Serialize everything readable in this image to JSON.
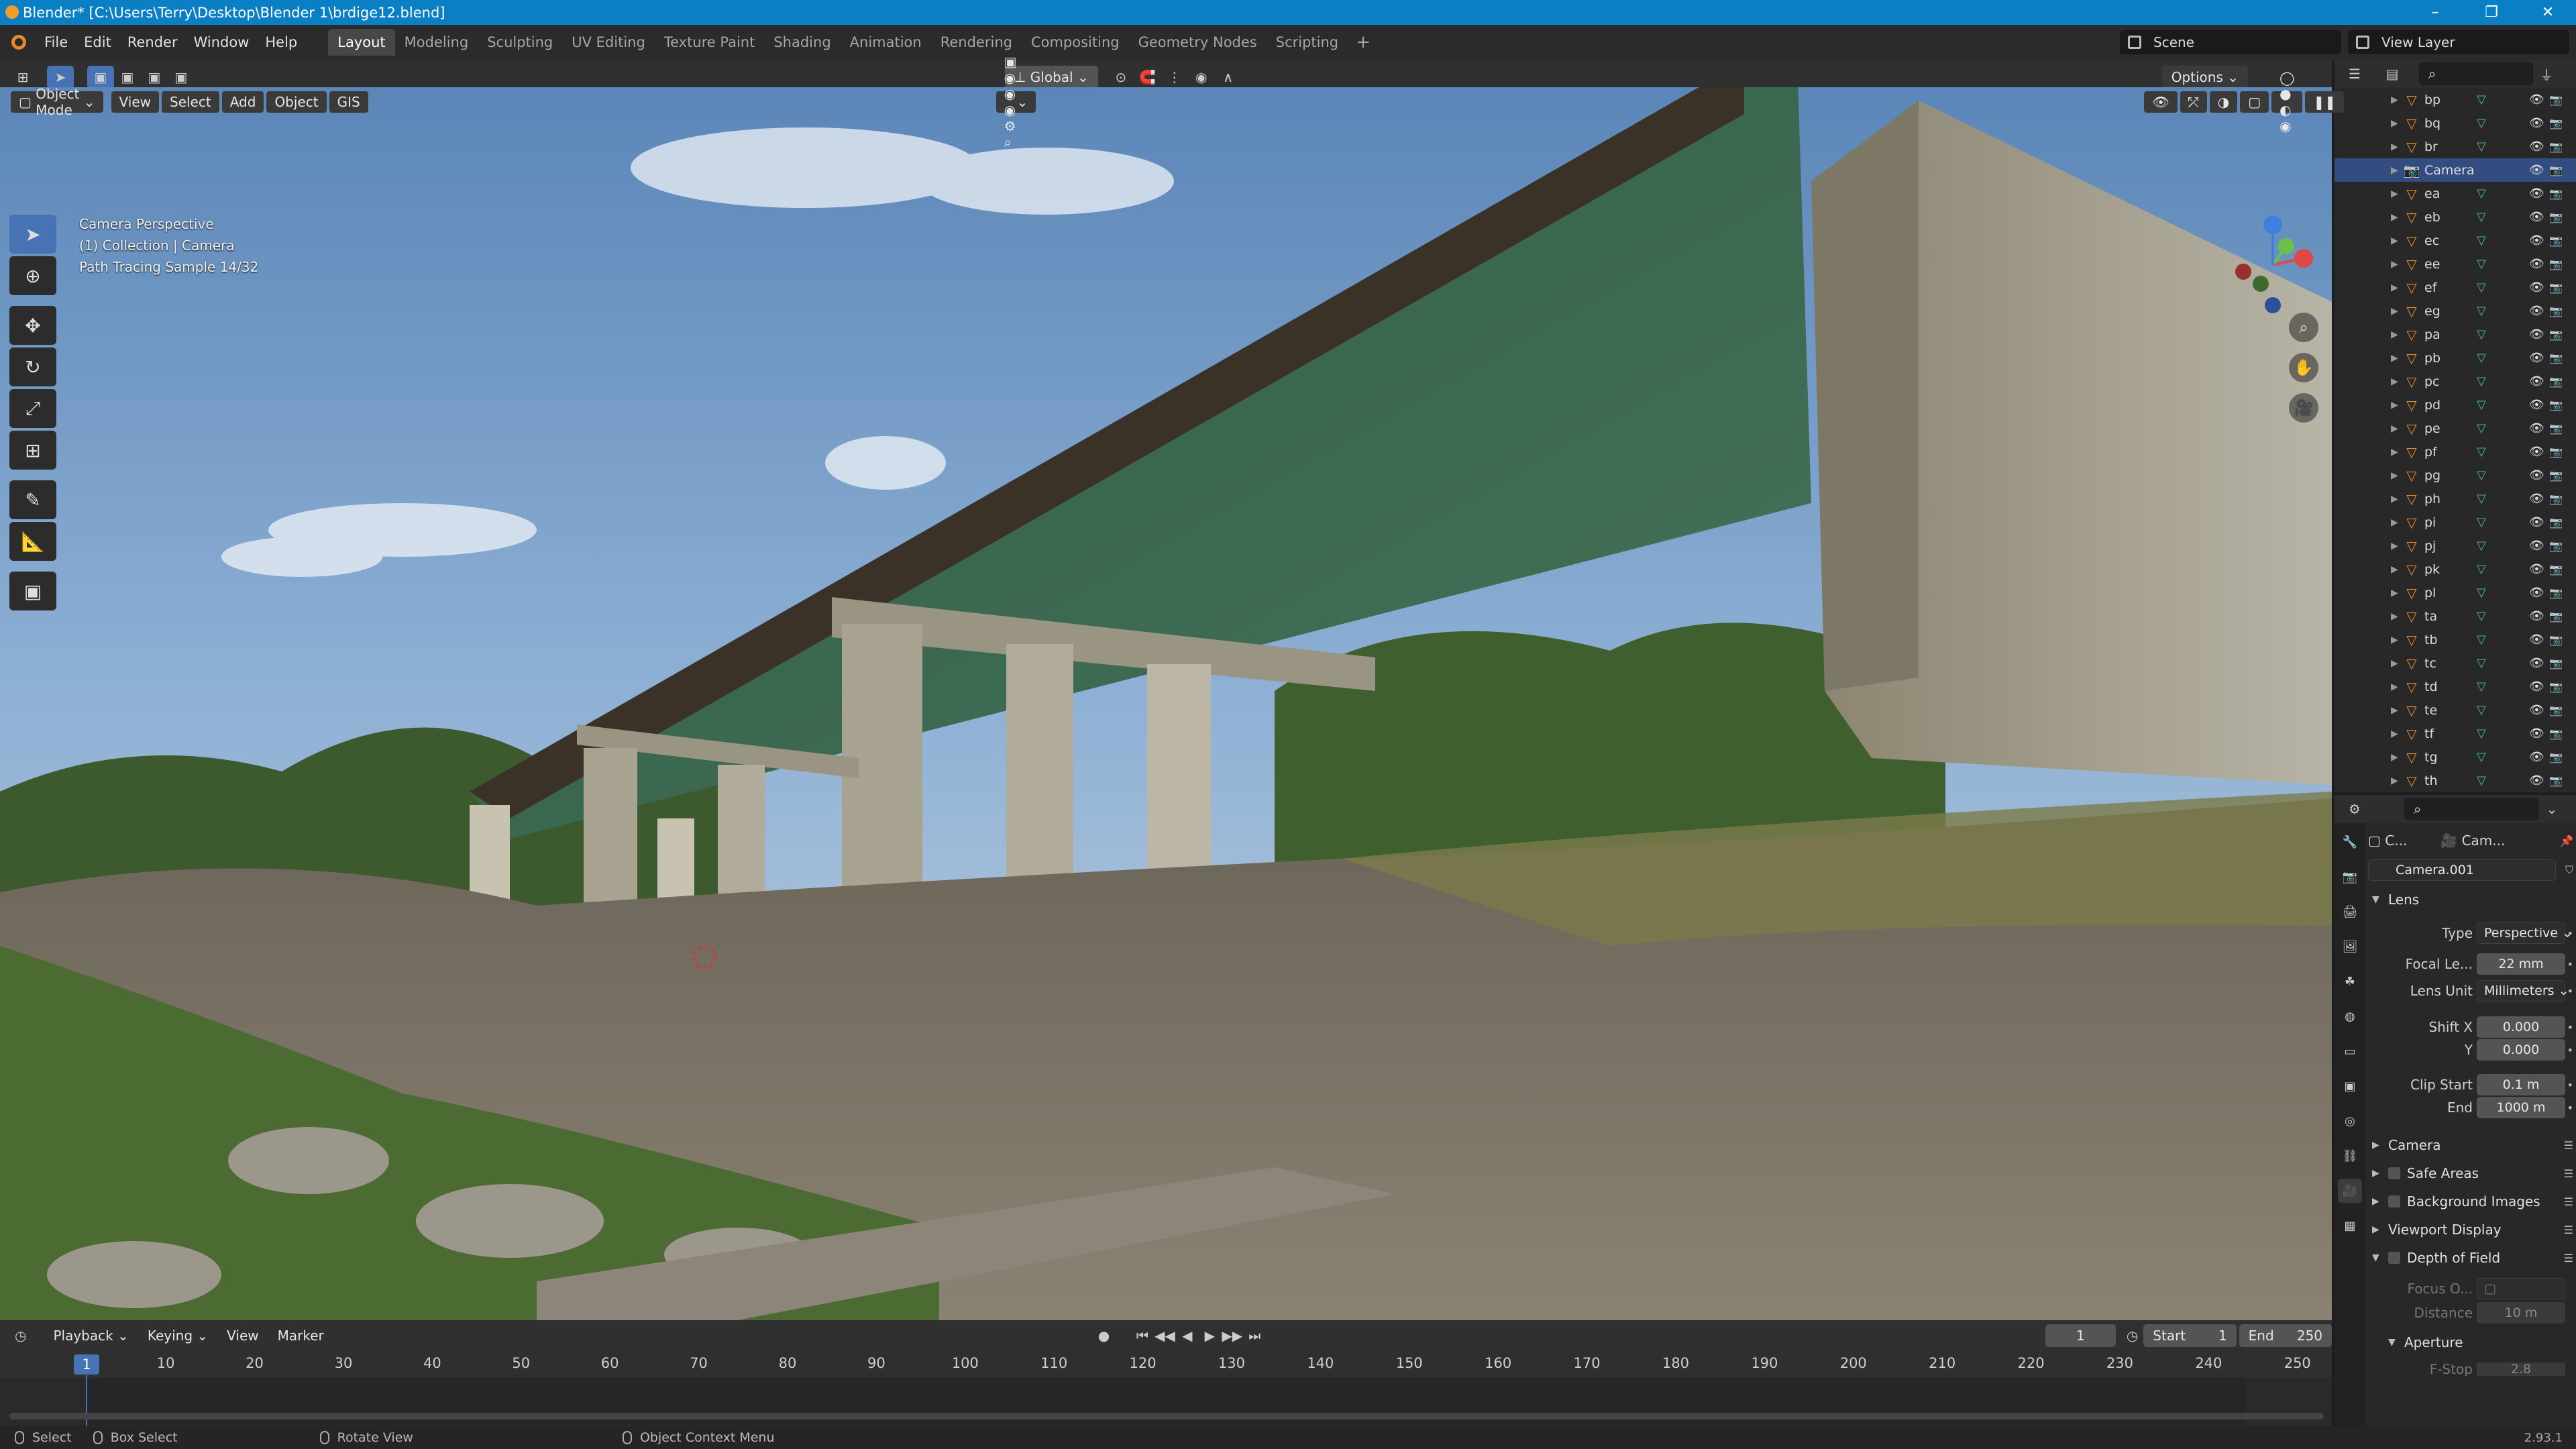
{
  "window": {
    "title": "Blender* [C:\\Users\\Terry\\Desktop\\Blender 1\\brdige12.blend]"
  },
  "menu": [
    "File",
    "Edit",
    "Render",
    "Window",
    "Help"
  ],
  "workspaces": [
    "Layout",
    "Modeling",
    "Sculpting",
    "UV Editing",
    "Texture Paint",
    "Shading",
    "Animation",
    "Rendering",
    "Compositing",
    "Geometry Nodes",
    "Scripting"
  ],
  "active_workspace": "Layout",
  "scene": "Scene",
  "view_layer": "View Layer",
  "header": {
    "transform_orientation": "Global",
    "options": "Options"
  },
  "viewport_header": {
    "mode": "Object Mode",
    "menus": [
      "View",
      "Select",
      "Add",
      "Object",
      "GIS"
    ]
  },
  "viewport": {
    "overlay_lines": [
      "Camera Perspective",
      "(1) Collection | Camera",
      "Path Tracing Sample 14/32"
    ]
  },
  "outliner": {
    "items": [
      "bp",
      "bq",
      "br",
      "Camera",
      "ea",
      "eb",
      "ec",
      "ee",
      "ef",
      "eg",
      "pa",
      "pb",
      "pc",
      "pd",
      "pe",
      "pf",
      "pg",
      "ph",
      "pi",
      "pj",
      "pk",
      "pl",
      "ta",
      "tb",
      "tc",
      "td",
      "te",
      "tf",
      "tg",
      "th"
    ],
    "selected": "Camera"
  },
  "properties": {
    "tabs_short": [
      "C...",
      "Cam..."
    ],
    "data_name": "Camera.001",
    "lens_section": "Lens",
    "type_label": "Type",
    "type_value": "Perspective",
    "focal_label": "Focal Le...",
    "focal_value": "22 mm",
    "lens_unit_label": "Lens Unit",
    "lens_unit_value": "Millimeters",
    "shift_x_label": "Shift X",
    "shift_x_value": "0.000",
    "shift_y_label": "Y",
    "shift_y_value": "0.000",
    "clip_start_label": "Clip Start",
    "clip_start_value": "0.1 m",
    "clip_end_label": "End",
    "clip_end_value": "1000 m",
    "sections": [
      "Camera",
      "Safe Areas",
      "Background Images",
      "Viewport Display",
      "Depth of Field"
    ],
    "focus_label": "Focus O...",
    "distance_label": "Distance",
    "distance_value": "10 m",
    "aperture": "Aperture",
    "fstop_label": "F-Stop",
    "fstop_value": "2.8"
  },
  "timeline": {
    "menus": [
      "Playback",
      "Keying",
      "View",
      "Marker"
    ],
    "current_frame": "1",
    "start_label": "Start",
    "start": "1",
    "end_label": "End",
    "end": "250",
    "ruler": [
      "10",
      "20",
      "30",
      "40",
      "50",
      "60",
      "70",
      "80",
      "90",
      "100",
      "110",
      "120",
      "130",
      "140",
      "150",
      "160",
      "170",
      "180",
      "190",
      "200",
      "210",
      "220",
      "230",
      "240",
      "250"
    ]
  },
  "status": {
    "select": "Select",
    "box_select": "Box Select",
    "rotate": "Rotate View",
    "context": "Object Context Menu",
    "version": "2.93.1"
  }
}
